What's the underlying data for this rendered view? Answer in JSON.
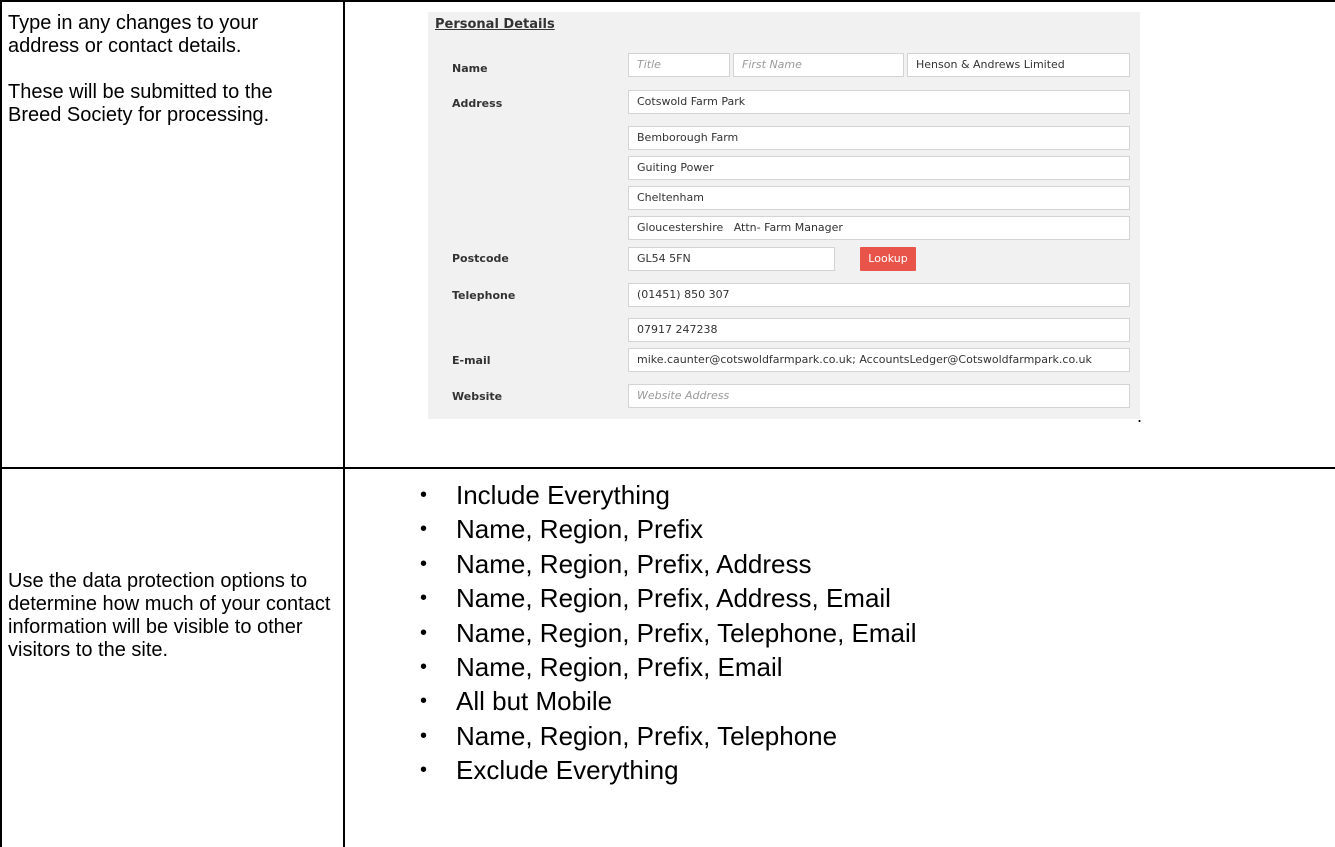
{
  "left_column": {
    "row1_paragraphs": [
      "Type in any changes to your address or contact details.",
      "These will be submitted to the Breed Society for processing."
    ],
    "row2_text": "Use the data protection options to determine how much of your contact information will be visible to other visitors to the site."
  },
  "form": {
    "title": "Personal Details",
    "labels": {
      "name": "Name",
      "address": "Address",
      "postcode": "Postcode",
      "telephone": "Telephone",
      "email": "E-mail",
      "website": "Website"
    },
    "name": {
      "title_placeholder": "Title",
      "first_name_placeholder": "First Name",
      "last_name": "Henson & Andrews Limited"
    },
    "address_lines": [
      "Cotswold Farm Park",
      "Bemborough Farm",
      "Guiting Power",
      "Cheltenham",
      "Gloucestershire   Attn- Farm Manager"
    ],
    "postcode": "GL54 5FN",
    "lookup_label": "Lookup",
    "telephone": "(01451) 850 307",
    "mobile": "07917 247238",
    "email": "mike.caunter@cotswoldfarmpark.co.uk; AccountsLedger@Cotswoldfarmpark.co.uk",
    "website_placeholder": "Website Address"
  },
  "stray_mark": ".",
  "bullet_glyph": "•",
  "data_protection_options": [
    "Include Everything",
    "Name, Region, Prefix",
    "Name, Region, Prefix, Address",
    "Name, Region, Prefix, Address, Email",
    "Name, Region, Prefix, Telephone, Email",
    "Name, Region, Prefix, Email",
    "All but Mobile",
    "Name, Region, Prefix, Telephone",
    "Exclude Everything"
  ]
}
